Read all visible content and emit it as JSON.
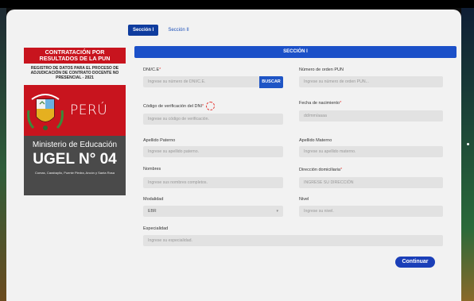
{
  "tabs": [
    {
      "label": "Sección I",
      "active": true
    },
    {
      "label": "Sección II",
      "active": false
    }
  ],
  "sidebar": {
    "title": "CONTRATACIÓN POR RESULTADOS DE LA PUN",
    "description": "REGISTRO DE DATOS PARA EL PROCESO DE ADJUDICACIÓN DE CONTRATO DOCENTE NO PRESENCIAL - 2021",
    "country": "PERÚ",
    "ministry": "Ministerio de Educación",
    "ugel": "UGEL N° 04",
    "ugel_districts": "Comas, Carabayllo, Puente Piedra, Ancón y Santa Rosa",
    "crest_icon": "peru-coat-of-arms-icon"
  },
  "form": {
    "section_title": "SECCIÓN I",
    "dni": {
      "label": "DNI/C.E",
      "required": true,
      "placeholder": "Ingrese su número de DNI/C.E."
    },
    "buscar_label": "BUSCAR",
    "orden_pun": {
      "label": "Número de orden PUN",
      "required": false,
      "placeholder": "Ingrese su número de orden PUN..."
    },
    "codigo": {
      "label": "Código de verificación del DNI",
      "required": true,
      "placeholder": "Ingrese su código de verificación."
    },
    "fecha": {
      "label": "Fecha de nacimiento",
      "required": true,
      "placeholder": "dd/mm/aaaa"
    },
    "ap_paterno": {
      "label": "Apellido Paterno",
      "placeholder": "Ingrese su apellido paterno."
    },
    "ap_materno": {
      "label": "Apellido Materno",
      "placeholder": "Ingrese su apellido materno."
    },
    "nombres": {
      "label": "Nombres",
      "placeholder": "Ingrese sus nombres completos."
    },
    "direccion": {
      "label": "Dirección domiciliaria",
      "required": true,
      "placeholder": "INGRESE SU DIRECCIÓN"
    },
    "modalidad": {
      "label": "Modalidad",
      "value": "EBR"
    },
    "nivel": {
      "label": "Nivel",
      "placeholder": "Ingrese su nivel."
    },
    "especialidad": {
      "label": "Especialidad",
      "placeholder": "Ingrese su especialidad."
    },
    "continuar_label": "Continuar"
  },
  "colors": {
    "primary": "#1b50c8",
    "brand_red": "#c8141e",
    "ministry_gray": "#4a4a4a",
    "required": "#e53935"
  }
}
